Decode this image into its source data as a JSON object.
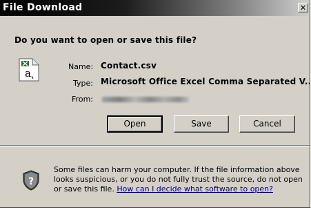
{
  "window": {
    "title": "File Download",
    "close_glyph": "✕"
  },
  "prompt": {
    "question": "Do you want to open or save this file?"
  },
  "file_info": {
    "icon": "csv-file-icon",
    "name_label": "Name:",
    "name_value": "Contact.csv",
    "type_label": "Type:",
    "type_value": "Microsoft Office Excel Comma Separated V...",
    "from_label": "From:"
  },
  "buttons": {
    "open": "Open",
    "save": "Save",
    "cancel": "Cancel"
  },
  "warning": {
    "icon": "shield-question-icon",
    "text": "Some files can harm your computer. If the file information above looks suspicious, or you do not fully trust the source, do not open or save this file.",
    "link": "How can I decide what software to open?"
  },
  "colors": {
    "dialog_bg": "#d4d0c8",
    "title_bar_start": "#000000",
    "title_bar_end": "#cfcfcf",
    "link": "#000080"
  }
}
